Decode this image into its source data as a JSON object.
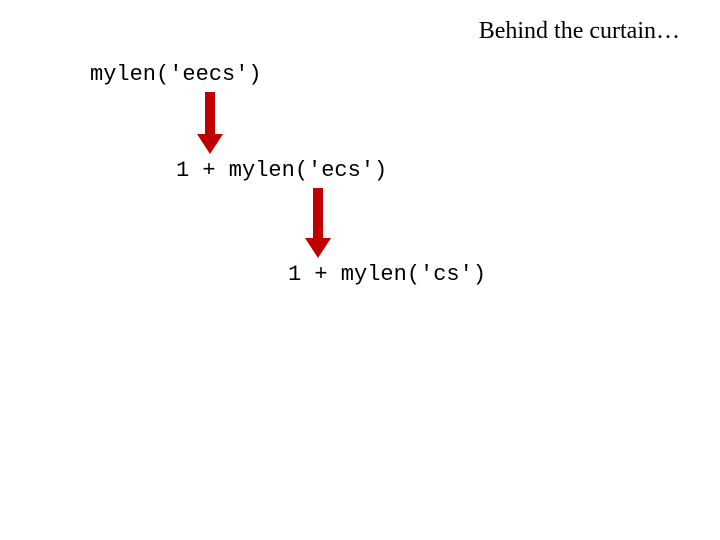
{
  "title": "Behind the curtain…",
  "steps": {
    "s1": "mylen('eecs')",
    "s2": "1 + mylen('ecs')",
    "s3": "1 + mylen('cs')"
  }
}
